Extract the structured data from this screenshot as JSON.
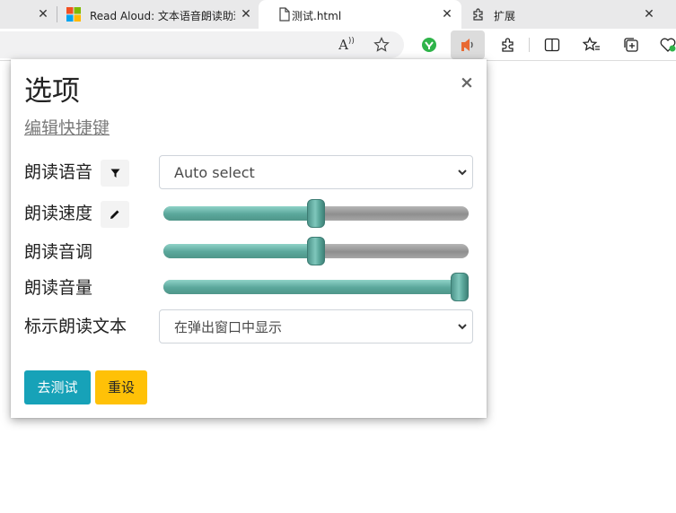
{
  "tabs": [
    {
      "title": "",
      "close": "✕"
    },
    {
      "title": "Read Aloud: 文本语音朗读助理",
      "close": "✕"
    },
    {
      "title": "测试.html",
      "close": "✕"
    },
    {
      "title": "扩展",
      "close": "✕"
    }
  ],
  "toolbar": {
    "read_aloud_text": "A",
    "icons": [
      "read-aloud-icon",
      "favorite-icon",
      "extension-green-icon",
      "read-aloud-extension-icon",
      "extensions-icon",
      "split-screen-icon",
      "favorites-icon",
      "collections-icon",
      "heart-icon"
    ]
  },
  "popup": {
    "title": "选项",
    "close": "×",
    "shortcut_link": "编辑快捷键",
    "voice": {
      "label": "朗读语音",
      "value": "Auto select"
    },
    "rate": {
      "label": "朗读速度",
      "level": 0.5
    },
    "pitch": {
      "label": "朗读音调",
      "level": 0.5
    },
    "volume": {
      "label": "朗读音量",
      "level": 1.0
    },
    "highlight": {
      "label": "标示朗读文本",
      "value": "在弹出窗口中显示"
    },
    "test_button": "去测试",
    "reset_button": "重设"
  },
  "colors": {
    "test_button": "#17a2b8",
    "reset_button": "#ffc107",
    "slider_fill": "#5aa79b",
    "slider_rest": "#9e9e9e"
  }
}
